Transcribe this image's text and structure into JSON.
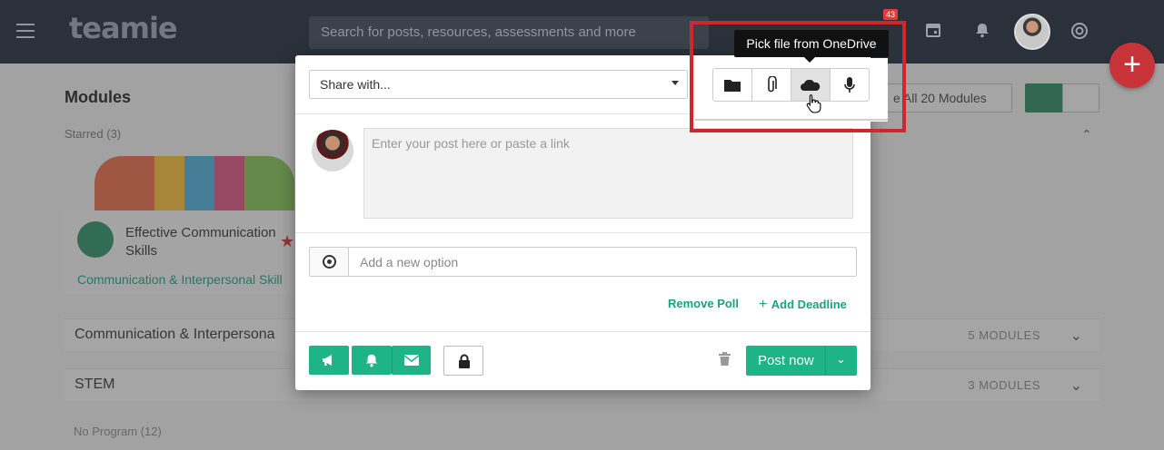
{
  "header": {
    "logo_text": "teamie",
    "search_placeholder": "Search for posts, resources, assessments and more",
    "notification_badge": "43",
    "icons": [
      "menu-icon",
      "calendar-icon",
      "bell-icon",
      "avatar",
      "help-icon"
    ]
  },
  "background_page": {
    "title": "Modules",
    "starred_label": "Starred (3)",
    "course_title": "Effective Communication Skills",
    "course_category": "Communication & Interpersonal Skill",
    "all_modules_button": "e All 20 Modules",
    "groups": [
      {
        "name": "Communication & Interpersona",
        "count": "5 MODULES"
      },
      {
        "name": "STEM",
        "count": "3 MODULES"
      }
    ],
    "no_program_label": "No Program (12)"
  },
  "composer": {
    "share_with": "Share with...",
    "post_placeholder": "Enter your post here or paste a link",
    "poll_option_placeholder": "Add a new option",
    "remove_poll": "Remove Poll",
    "add_deadline": "Add Deadline",
    "post_now": "Post now"
  },
  "attachment_toolbar": {
    "tooltip": "Pick file from OneDrive",
    "buttons": [
      "folder-icon",
      "paperclip-icon",
      "onedrive-cloud-icon",
      "microphone-icon"
    ],
    "active_button": "onedrive-cloud-icon"
  },
  "colors": {
    "header_bg": "#2b313a",
    "accent_green": "#1fb388",
    "highlight_red": "#d1262b",
    "fab_red": "#c8333a"
  }
}
